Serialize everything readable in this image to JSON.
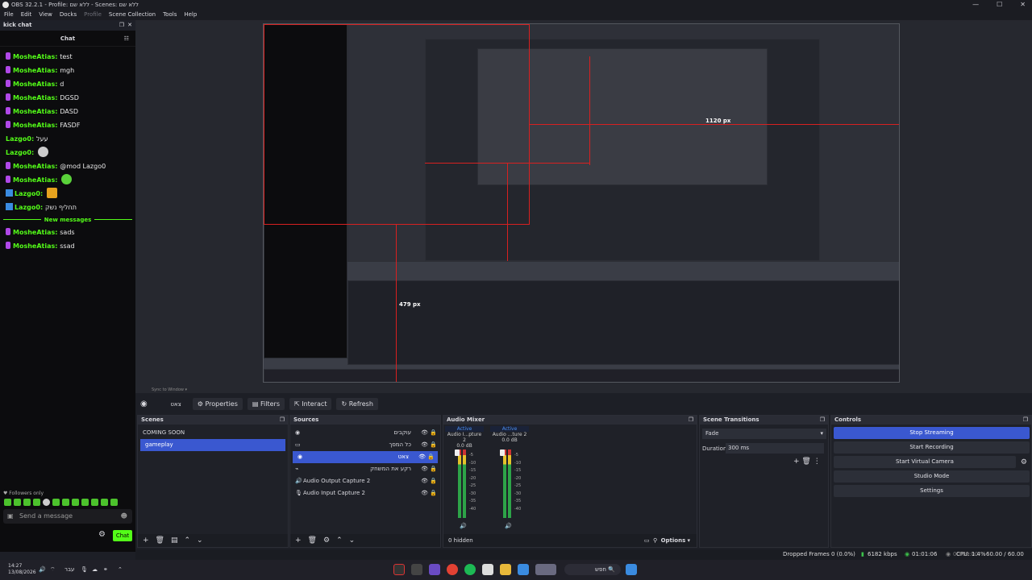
{
  "window": {
    "title": "OBS 32.2.1 - Profile: ללא שם - Scenes: ללא שם",
    "minimize": "—",
    "maximize": "☐",
    "close": "✕"
  },
  "menu": [
    "File",
    "Edit",
    "View",
    "Docks",
    "Profile",
    "Scene Collection",
    "Tools",
    "Help"
  ],
  "chat": {
    "dock_title": "kick chat",
    "header": "Chat",
    "messages": [
      {
        "user": "MosheAtias",
        "text": "test",
        "badge": true
      },
      {
        "user": "MosheAtias",
        "text": "mgh",
        "badge": true
      },
      {
        "user": "MosheAtias",
        "text": "d",
        "badge": true
      },
      {
        "user": "MosheAtias",
        "text": "DGSD",
        "badge": true
      },
      {
        "user": "MosheAtias",
        "text": "DASD",
        "badge": true
      },
      {
        "user": "MosheAtias",
        "text": "FASDF",
        "badge": true
      },
      {
        "user": "Lazgo0",
        "text": "עעל",
        "badge": false
      },
      {
        "user": "Lazgo0",
        "text": "",
        "badge": false,
        "emote": true
      },
      {
        "user": "MosheAtias",
        "text": "@mod Lazgo0",
        "badge": true
      },
      {
        "user": "MosheAtias",
        "text": "",
        "badge": true,
        "emote": true
      },
      {
        "user": "Lazgo0",
        "text": "",
        "badge": false,
        "kbadge": true,
        "emote": true
      },
      {
        "user": "Lazgo0",
        "text": "תחליף נשק",
        "badge": false,
        "kbadge": true
      }
    ],
    "separator": "New messages",
    "new_messages": [
      {
        "user": "MosheAtias",
        "text": "sads"
      },
      {
        "user": "MosheAtias",
        "text": "ssad"
      }
    ],
    "followers_only": "♥ Followers only",
    "input_placeholder": "Send a message",
    "send_label": "Chat"
  },
  "preview": {
    "measure_x": "1120 px",
    "measure_y": "479 px",
    "bottom_info": "Sync to Window"
  },
  "toolbar": {
    "source_name": "צאט",
    "properties": "Properties",
    "filters": "Filters",
    "interact": "Interact",
    "refresh": "Refresh"
  },
  "scenes": {
    "title": "Scenes",
    "items": [
      {
        "name": "COMING SOON"
      },
      {
        "name": "gameplay",
        "selected": true
      }
    ]
  },
  "sources": {
    "title": "Sources",
    "items": [
      {
        "name": "עוקבים",
        "icon": "browser-icon"
      },
      {
        "name": "כל המסך",
        "icon": "monitor-icon"
      },
      {
        "name": "צאט",
        "icon": "browser-icon",
        "selected": true
      },
      {
        "name": "רקע את המשחק",
        "icon": "gamepad-icon"
      },
      {
        "name": "Audio Output Capture 2",
        "icon": "speaker-icon"
      },
      {
        "name": "Audio Input Capture 2",
        "icon": "mic-icon"
      }
    ]
  },
  "mixer": {
    "title": "Audio Mixer",
    "channels": [
      {
        "label": "Audio I...pture 2",
        "status": "Active",
        "db": "0.0 dB"
      },
      {
        "label": "Audio ...ture 2",
        "status": "Active",
        "db": "0.0 dB"
      }
    ],
    "scale": [
      "-5",
      "-10",
      "-15",
      "-20",
      "-25",
      "-30",
      "-35",
      "-40",
      "-45",
      "-50",
      "-55",
      "-60"
    ],
    "hidden": "0 hidden",
    "options": "Options"
  },
  "transitions": {
    "title": "Scene Transitions",
    "type": "Fade",
    "duration_label": "Duration",
    "duration": "300 ms"
  },
  "controls": {
    "title": "Controls",
    "buttons": [
      "Stop Streaming",
      "Start Recording",
      "Start Virtual Camera",
      "Studio Mode",
      "Settings"
    ]
  },
  "status": {
    "dropped": "Dropped Frames 0 (0.0%)",
    "kbps": "6182 kbps",
    "stream_time": "01:01:06",
    "rec_time": "00:00:00",
    "cpu": "CPU: 1.4%",
    "fps": "60.00 / 60.00 FPS"
  },
  "taskbar": {
    "time": "14:27",
    "date": "13/08/2026",
    "lang": "עבר",
    "search": "חפש"
  },
  "colors": {
    "accent": "#3a58d0",
    "kick_green": "#53fc18",
    "guide_red": "#d82020"
  }
}
